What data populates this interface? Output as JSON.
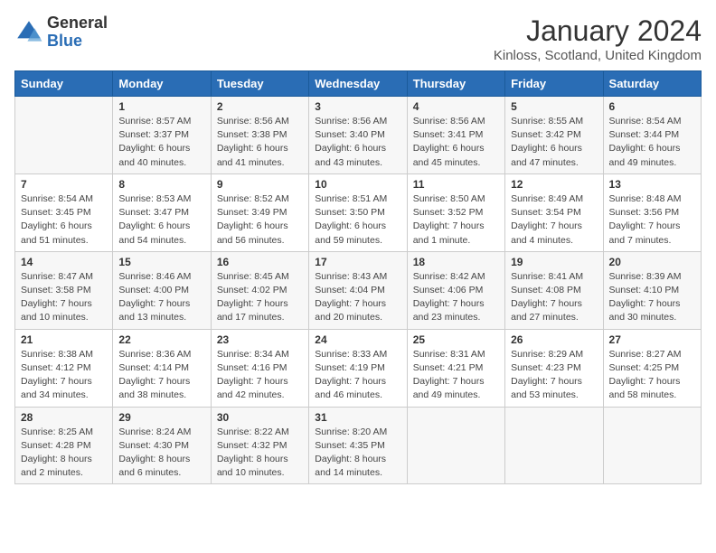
{
  "logo": {
    "general": "General",
    "blue": "Blue"
  },
  "title": "January 2024",
  "location": "Kinloss, Scotland, United Kingdom",
  "headers": [
    "Sunday",
    "Monday",
    "Tuesday",
    "Wednesday",
    "Thursday",
    "Friday",
    "Saturday"
  ],
  "weeks": [
    [
      {
        "day": "",
        "info": ""
      },
      {
        "day": "1",
        "info": "Sunrise: 8:57 AM\nSunset: 3:37 PM\nDaylight: 6 hours\nand 40 minutes."
      },
      {
        "day": "2",
        "info": "Sunrise: 8:56 AM\nSunset: 3:38 PM\nDaylight: 6 hours\nand 41 minutes."
      },
      {
        "day": "3",
        "info": "Sunrise: 8:56 AM\nSunset: 3:40 PM\nDaylight: 6 hours\nand 43 minutes."
      },
      {
        "day": "4",
        "info": "Sunrise: 8:56 AM\nSunset: 3:41 PM\nDaylight: 6 hours\nand 45 minutes."
      },
      {
        "day": "5",
        "info": "Sunrise: 8:55 AM\nSunset: 3:42 PM\nDaylight: 6 hours\nand 47 minutes."
      },
      {
        "day": "6",
        "info": "Sunrise: 8:54 AM\nSunset: 3:44 PM\nDaylight: 6 hours\nand 49 minutes."
      }
    ],
    [
      {
        "day": "7",
        "info": "Sunrise: 8:54 AM\nSunset: 3:45 PM\nDaylight: 6 hours\nand 51 minutes."
      },
      {
        "day": "8",
        "info": "Sunrise: 8:53 AM\nSunset: 3:47 PM\nDaylight: 6 hours\nand 54 minutes."
      },
      {
        "day": "9",
        "info": "Sunrise: 8:52 AM\nSunset: 3:49 PM\nDaylight: 6 hours\nand 56 minutes."
      },
      {
        "day": "10",
        "info": "Sunrise: 8:51 AM\nSunset: 3:50 PM\nDaylight: 6 hours\nand 59 minutes."
      },
      {
        "day": "11",
        "info": "Sunrise: 8:50 AM\nSunset: 3:52 PM\nDaylight: 7 hours\nand 1 minute."
      },
      {
        "day": "12",
        "info": "Sunrise: 8:49 AM\nSunset: 3:54 PM\nDaylight: 7 hours\nand 4 minutes."
      },
      {
        "day": "13",
        "info": "Sunrise: 8:48 AM\nSunset: 3:56 PM\nDaylight: 7 hours\nand 7 minutes."
      }
    ],
    [
      {
        "day": "14",
        "info": "Sunrise: 8:47 AM\nSunset: 3:58 PM\nDaylight: 7 hours\nand 10 minutes."
      },
      {
        "day": "15",
        "info": "Sunrise: 8:46 AM\nSunset: 4:00 PM\nDaylight: 7 hours\nand 13 minutes."
      },
      {
        "day": "16",
        "info": "Sunrise: 8:45 AM\nSunset: 4:02 PM\nDaylight: 7 hours\nand 17 minutes."
      },
      {
        "day": "17",
        "info": "Sunrise: 8:43 AM\nSunset: 4:04 PM\nDaylight: 7 hours\nand 20 minutes."
      },
      {
        "day": "18",
        "info": "Sunrise: 8:42 AM\nSunset: 4:06 PM\nDaylight: 7 hours\nand 23 minutes."
      },
      {
        "day": "19",
        "info": "Sunrise: 8:41 AM\nSunset: 4:08 PM\nDaylight: 7 hours\nand 27 minutes."
      },
      {
        "day": "20",
        "info": "Sunrise: 8:39 AM\nSunset: 4:10 PM\nDaylight: 7 hours\nand 30 minutes."
      }
    ],
    [
      {
        "day": "21",
        "info": "Sunrise: 8:38 AM\nSunset: 4:12 PM\nDaylight: 7 hours\nand 34 minutes."
      },
      {
        "day": "22",
        "info": "Sunrise: 8:36 AM\nSunset: 4:14 PM\nDaylight: 7 hours\nand 38 minutes."
      },
      {
        "day": "23",
        "info": "Sunrise: 8:34 AM\nSunset: 4:16 PM\nDaylight: 7 hours\nand 42 minutes."
      },
      {
        "day": "24",
        "info": "Sunrise: 8:33 AM\nSunset: 4:19 PM\nDaylight: 7 hours\nand 46 minutes."
      },
      {
        "day": "25",
        "info": "Sunrise: 8:31 AM\nSunset: 4:21 PM\nDaylight: 7 hours\nand 49 minutes."
      },
      {
        "day": "26",
        "info": "Sunrise: 8:29 AM\nSunset: 4:23 PM\nDaylight: 7 hours\nand 53 minutes."
      },
      {
        "day": "27",
        "info": "Sunrise: 8:27 AM\nSunset: 4:25 PM\nDaylight: 7 hours\nand 58 minutes."
      }
    ],
    [
      {
        "day": "28",
        "info": "Sunrise: 8:25 AM\nSunset: 4:28 PM\nDaylight: 8 hours\nand 2 minutes."
      },
      {
        "day": "29",
        "info": "Sunrise: 8:24 AM\nSunset: 4:30 PM\nDaylight: 8 hours\nand 6 minutes."
      },
      {
        "day": "30",
        "info": "Sunrise: 8:22 AM\nSunset: 4:32 PM\nDaylight: 8 hours\nand 10 minutes."
      },
      {
        "day": "31",
        "info": "Sunrise: 8:20 AM\nSunset: 4:35 PM\nDaylight: 8 hours\nand 14 minutes."
      },
      {
        "day": "",
        "info": ""
      },
      {
        "day": "",
        "info": ""
      },
      {
        "day": "",
        "info": ""
      }
    ]
  ]
}
